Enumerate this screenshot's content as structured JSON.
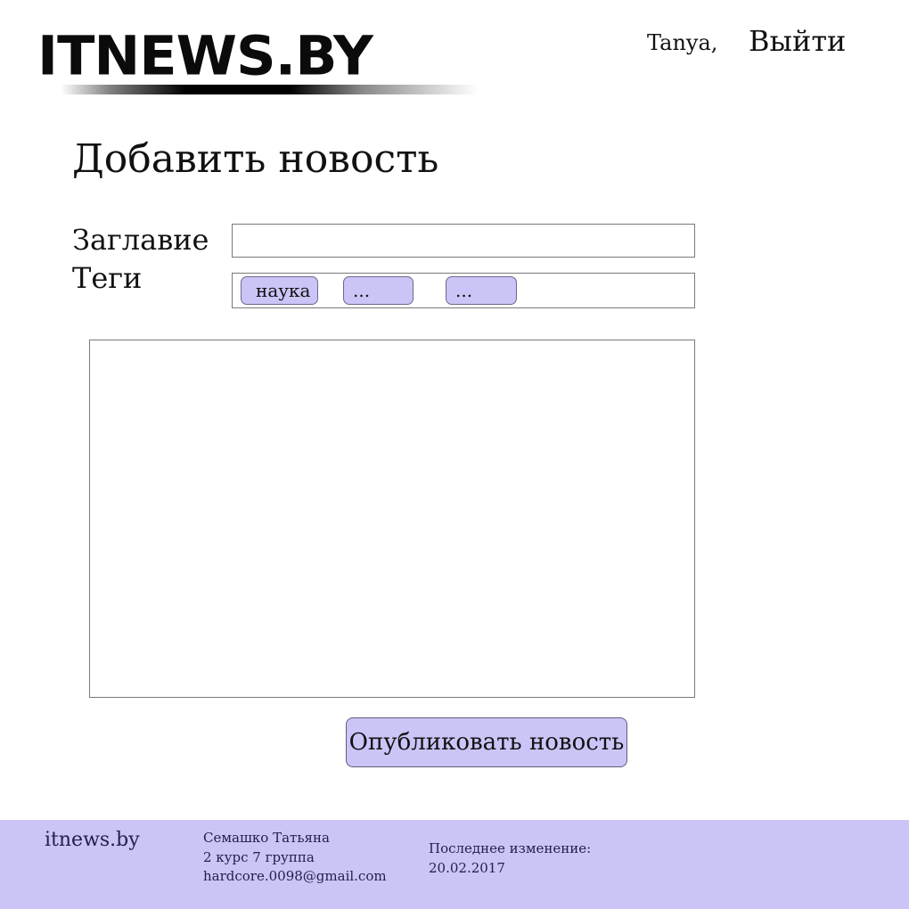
{
  "header": {
    "logo_text": "ITNEWS.BY",
    "user_name": "Tanya,",
    "logout_label": "Выйти"
  },
  "form": {
    "page_title": "Добавить новость",
    "title_label": "Заглавие",
    "title_value": "",
    "tags_label": "Теги",
    "tags": [
      "наука",
      "...",
      "..."
    ],
    "content_value": "",
    "publish_label": "Опубликовать новость"
  },
  "footer": {
    "site": "itnews.by",
    "author_name": "Семашко Татьяна",
    "author_group": "2 курс 7 группа",
    "author_email": "hardcore.0098@gmail.com",
    "modified_label": "Последнее изменение:",
    "modified_date": "20.02.2017"
  },
  "colors": {
    "accent": "#cbc5f7",
    "border": "#7a7a7a",
    "text": "#111111"
  }
}
